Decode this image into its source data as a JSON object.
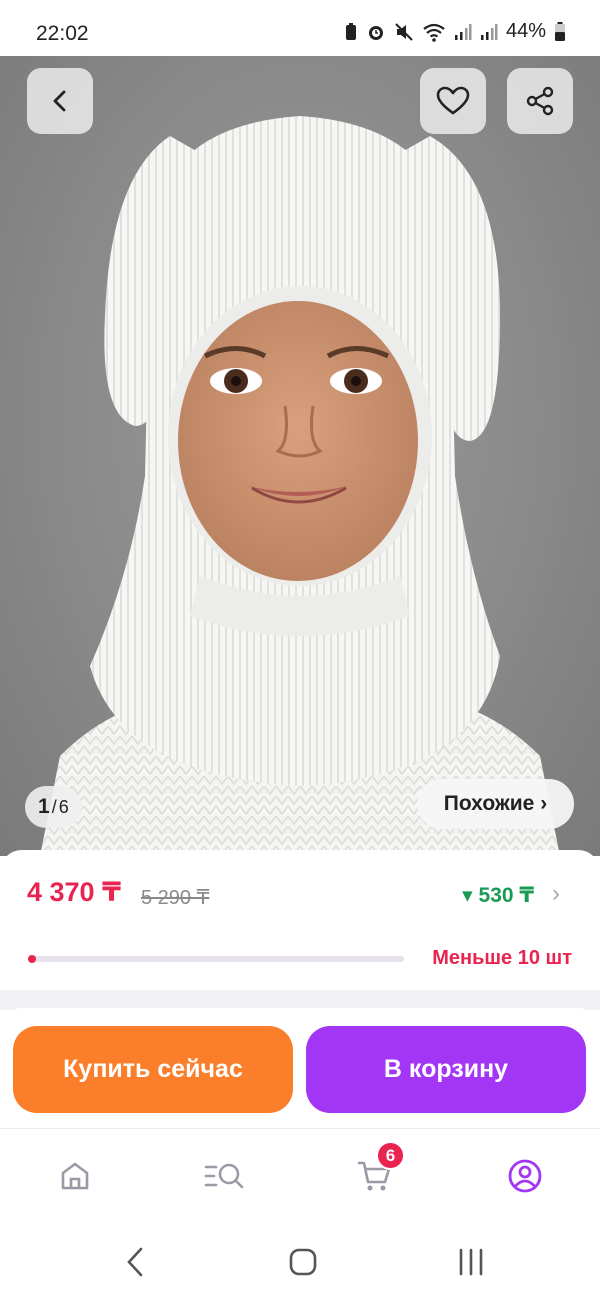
{
  "status_bar": {
    "time": "22:02",
    "battery": "44%",
    "icons": [
      "battery-saver-icon",
      "alarm-icon",
      "mute-icon",
      "wifi-icon",
      "signal-icon",
      "signal-icon",
      "battery-icon"
    ]
  },
  "gallery": {
    "current": "1",
    "separator": "/",
    "total": "6",
    "similar_label": "Похожие ›"
  },
  "top_actions": {
    "back_icon": "chevron-left-icon",
    "favorite_icon": "heart-icon",
    "share_icon": "share-icon"
  },
  "price": {
    "current": "4 370 ₸",
    "old": "5 290 ₸",
    "bonus": "▾ 530 ₸",
    "bonus_arrow": "›",
    "stock_label": "Меньше 10 шт",
    "stock_level": 0.02
  },
  "actions": {
    "buy_now": "Купить сейчас",
    "add_to_cart": "В корзину"
  },
  "tabbar": {
    "cart_count": "6",
    "items": [
      "home-icon",
      "catalog-search-icon",
      "cart-icon",
      "profile-icon"
    ]
  },
  "colors": {
    "accent_red": "#e8244f",
    "bonus_green": "#1a9b55",
    "buy_orange": "#fb7f2b",
    "cart_purple": "#a336f5"
  }
}
